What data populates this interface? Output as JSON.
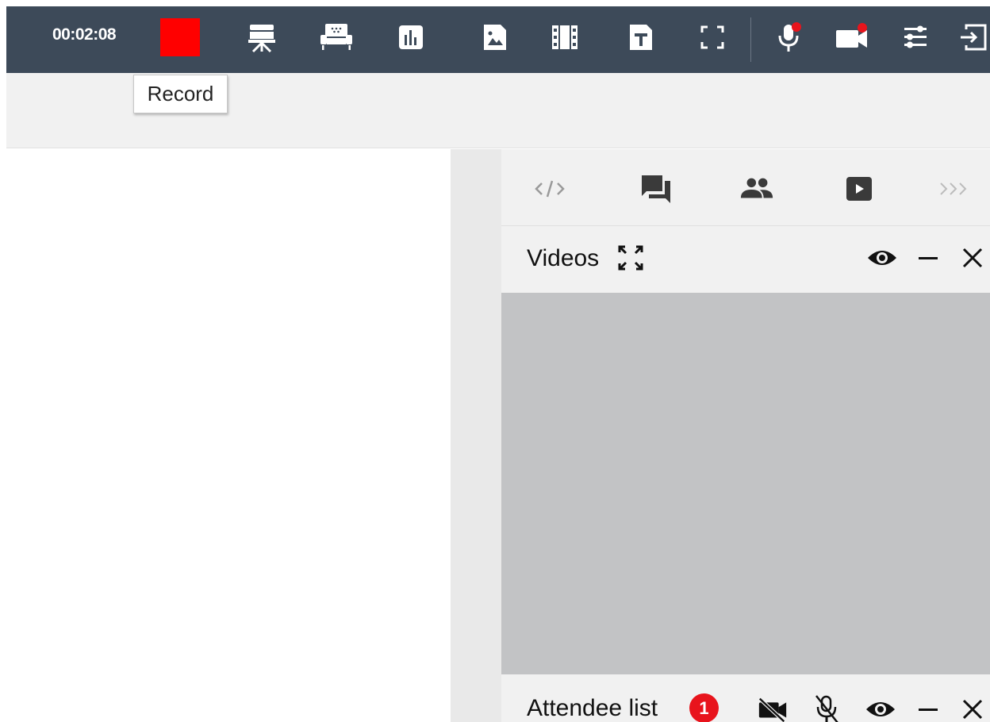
{
  "toolbar": {
    "timer": "00:02:08",
    "record_color": "#ff0000",
    "background": "#3d4a59",
    "icons": [
      "presentation-icon",
      "whiteboard-icon",
      "poll-icon",
      "image-icon",
      "video-film-icon",
      "text-document-icon",
      "fullscreen-icon",
      "microphone-icon",
      "camera-icon",
      "settings-sliders-icon",
      "exit-icon"
    ]
  },
  "tooltip": {
    "text": "Record"
  },
  "panel": {
    "tabs": [
      "code-icon",
      "chat-icon",
      "people-icon",
      "play-video-icon",
      "more-chevrons-icon"
    ],
    "videos": {
      "title": "Videos"
    },
    "attendees": {
      "title": "Attendee list",
      "count": "1"
    }
  }
}
